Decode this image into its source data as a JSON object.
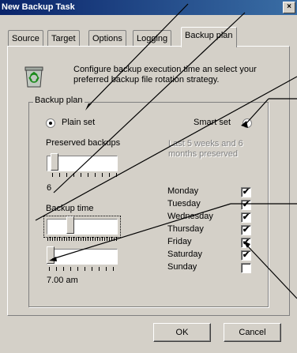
{
  "window": {
    "title": "New Backup Task",
    "close_label": "×"
  },
  "tabs": [
    {
      "label": "Source"
    },
    {
      "label": "Target"
    },
    {
      "label": "Options"
    },
    {
      "label": "Logging"
    },
    {
      "label": "Backup plan",
      "active": true
    }
  ],
  "header": {
    "icon": "recycle-bin-icon",
    "text": "Configure backup execution time an select your preferred backup file rotation strategy."
  },
  "backup_plan": {
    "group_label": "Backup plan",
    "plain_set_label": "Plain set",
    "plain_set_selected": true,
    "smart_set_label": "Smart set",
    "smart_set_selected": false,
    "preserved_label": "Preserved backups",
    "preserved_value": "6",
    "smart_note": "Last 5 weeks and 6 months preserved",
    "backup_time_label": "Backup time",
    "time_value": "7.00 am"
  },
  "days": [
    {
      "label": "Monday",
      "checked": true
    },
    {
      "label": "Tuesday",
      "checked": true
    },
    {
      "label": "Wednesday",
      "checked": true
    },
    {
      "label": "Thursday",
      "checked": true
    },
    {
      "label": "Friday",
      "checked": true
    },
    {
      "label": "Saturday",
      "checked": true
    },
    {
      "label": "Sunday",
      "checked": false
    }
  ],
  "buttons": {
    "ok": "OK",
    "cancel": "Cancel"
  },
  "colors": {
    "titlebar": "#0a246a",
    "face": "#d4d0c8"
  }
}
